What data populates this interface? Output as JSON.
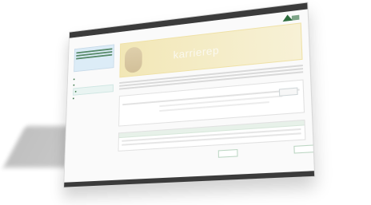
{
  "topbar": {
    "left": "",
    "right": ""
  },
  "nav": {
    "items": []
  },
  "sidebar": {
    "box_title": "",
    "items": []
  },
  "hero": {
    "text": "karrierep"
  },
  "main": {
    "section_title": "",
    "panel_title": "",
    "table_title": ""
  },
  "colors": {
    "accent": "#2c6b3c",
    "topbar": "#3b3b3b",
    "hero_bg": "#f2e7b6"
  }
}
